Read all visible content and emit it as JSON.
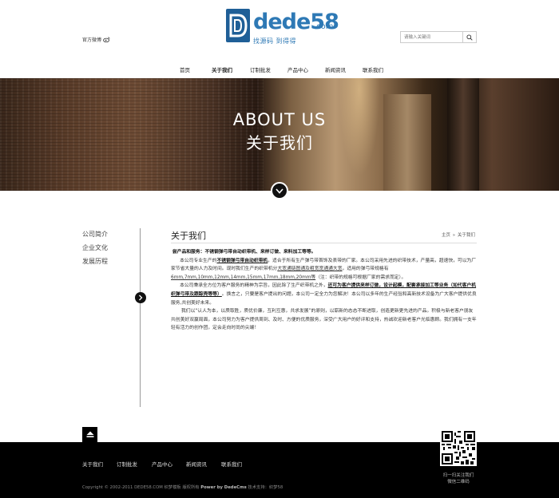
{
  "header": {
    "weibo_label": "官方微博",
    "logo": {
      "brand": "dede",
      "number": "58",
      "dotcom": ".com",
      "slogan": "找源码  到得得"
    },
    "search": {
      "placeholder": "请输入关键词"
    }
  },
  "nav": [
    "首页",
    "关于我们",
    "订制批发",
    "产品中心",
    "新闻资讯",
    "联系我们"
  ],
  "banner": {
    "title_en": "ABOUT US",
    "title_cn": "关于我们"
  },
  "sidebar": [
    "公司简介",
    "企业文化",
    "发展历程"
  ],
  "content": {
    "title": "关于我们",
    "breadcrumb": {
      "home": "主页",
      "sep": "»",
      "current": "关于我们"
    },
    "p1_label": "尝产品和服务：",
    "p1_text": "不锈钢弹弓带自动织带机、来样订做、来料加工等等。",
    "p2_a": "本公司专业生产的",
    "p2_u1": "不锈钢弹弓带自动织带机",
    "p2_b": "，适合于所有生产弹弓带首饰及表带的厂家。本公司采用先进的织带技术，产量高，超速快，可以为厂家节省大量的人力及时间。现时我们生产的织带机分",
    "p2_u2": "大宽通链图通及粗宽宽通通大宽",
    "p2_c": "，适用的弹弓带规格有",
    "p2_u3": "6mm,7mm,10mm,12mm,14mm,15mm,17mm,18mm,20mm等",
    "p2_d": "（注：织带的规格可根据厂家的需求而定）。",
    "p3_a": "本公司秉承全方位为客户服务的精神为宗旨，因此除了生产织带机之外，",
    "p3_hl": "还可为客户提供来样订做，设计起模，配套承接加工等业务（如代客户机织弹弓带及跟踪壳等等）",
    "p3_b": "。换言之，只要是客户提出的问题，本公司一定全力为您解决！本公司以多年的生产经验和高新技术设备为广大客户提供优良服务,共创美好未来。",
    "p4": "我们以“认人为本，以质取胜，质优价廉，互利互惠，共求发展”的原则，以崭新的态态不断进取，创造更新更先进的产品。积极与新老客户朋友共创美好双赢局面，本公司努力为客户提供周到、及时、方便的优质服务，深受广大用户的好评和支持，热诚欢迎新老客户光临惠顾。我们拥有一支年轻有活力的创作团，定会走向时尚的尖端！"
  },
  "footer": {
    "nav": [
      "关于我们",
      "订制批发",
      "产品中心",
      "新闻资讯",
      "联系我们"
    ],
    "copyright_a": "Copyright © 2002-2011 DEDE58.COM 织梦模板 版权所有 ",
    "copyright_b": "Power by DedeCms",
    "copyright_c": " 技术支持：织梦58",
    "qr_line1": "扫一扫关注我们",
    "qr_line2": "微信二维码"
  },
  "colors": {
    "brand_blue": "#2e79b5",
    "footer_bg": "#000000"
  }
}
